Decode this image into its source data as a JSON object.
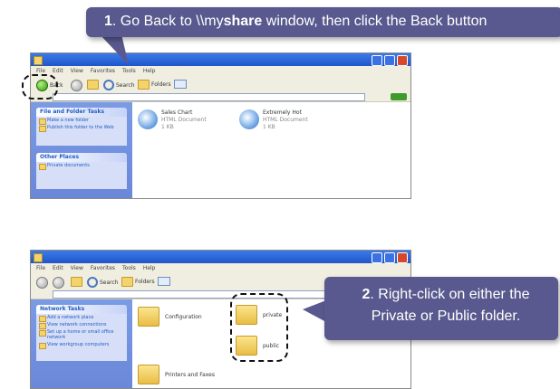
{
  "callouts": [
    {
      "step": "1",
      "before": ". Go Back to \\\\my",
      "bold": "share",
      "after": " window, then click the Back button"
    },
    {
      "step": "2",
      "text": ". Right-click on either the Private or Public folder."
    }
  ],
  "screen1": {
    "menu": [
      "File",
      "Edit",
      "View",
      "Favorites",
      "Tools",
      "Help"
    ],
    "toolbar": {
      "back": "Back",
      "search": "Search",
      "folders": "Folders"
    },
    "tasks_title": "File and Folder Tasks",
    "tasks": [
      "Make a new folder",
      "Publish this folder to the Web"
    ],
    "places_title": "Other Places",
    "places": [
      "Private documents"
    ],
    "files": [
      {
        "name": "Sales Chart",
        "type": "HTML Document",
        "size": "1 KB"
      },
      {
        "name": "Extremely Hot",
        "type": "HTML Document",
        "size": "1 KB"
      }
    ]
  },
  "screen2": {
    "menu": [
      "File",
      "Edit",
      "View",
      "Favorites",
      "Tools",
      "Help"
    ],
    "toolbar": {
      "back": "Back",
      "search": "Search",
      "folders": "Folders"
    },
    "tasks_title": "Network Tasks",
    "tasks": [
      "Add a network place",
      "View network connections",
      "Set up a home or small office network",
      "View workgroup computers"
    ],
    "folders": [
      "Configuration",
      "private",
      "public",
      "Printers and Faxes"
    ]
  }
}
